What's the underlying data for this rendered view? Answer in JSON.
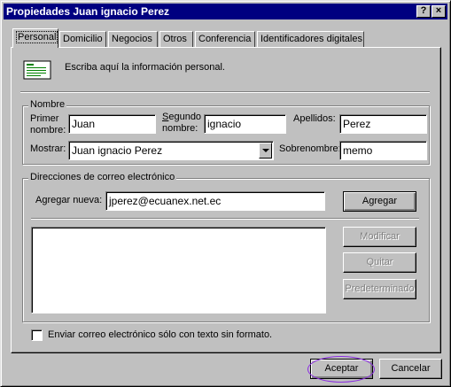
{
  "window": {
    "title": "Propiedades Juan ignacio Perez",
    "help_btn": "?",
    "close_btn": "×"
  },
  "tabs": [
    {
      "label": "Personal"
    },
    {
      "label": "Domicilio"
    },
    {
      "label": "Negocios"
    },
    {
      "label": "Otros"
    },
    {
      "label": "Conferencia"
    },
    {
      "label": "Identificadores digitales"
    }
  ],
  "intro": {
    "icon": "contact-card-icon",
    "text": "Escriba aquí la información personal."
  },
  "nombre": {
    "group_label": "Nombre",
    "primer_label_1": "Primer",
    "primer_label_2": "nombre:",
    "primer_value": "Juan",
    "segundo_label_1": "Segundo",
    "segundo_label_2": "nombre:",
    "segundo_value": "ignacio",
    "apellidos_label": "Apellidos:",
    "apellidos_value": "Perez",
    "mostrar_label": "Mostrar:",
    "mostrar_value": "Juan ignacio Perez",
    "sobrenombre_label": "Sobrenombre:",
    "sobrenombre_value": "memo"
  },
  "correo": {
    "group_label": "Direcciones de correo electrónico",
    "agregar_label": "Agregar nueva:",
    "agregar_value": "jperez@ecuanex.net.ec",
    "agregar_btn": "Agregar",
    "modificar_btn": "Modificar",
    "quitar_btn": "Quitar",
    "predeterminado_btn": "Predeterminado"
  },
  "plain_text_checkbox": {
    "label": "Enviar correo electrónico sólo con texto sin formato.",
    "checked": false
  },
  "footer": {
    "accept_btn": "Aceptar",
    "cancel_btn": "Cancelar"
  },
  "colors": {
    "titlebar": "#000080",
    "face": "#c0c0c0",
    "highlight_ellipse": "#8a2be2"
  }
}
